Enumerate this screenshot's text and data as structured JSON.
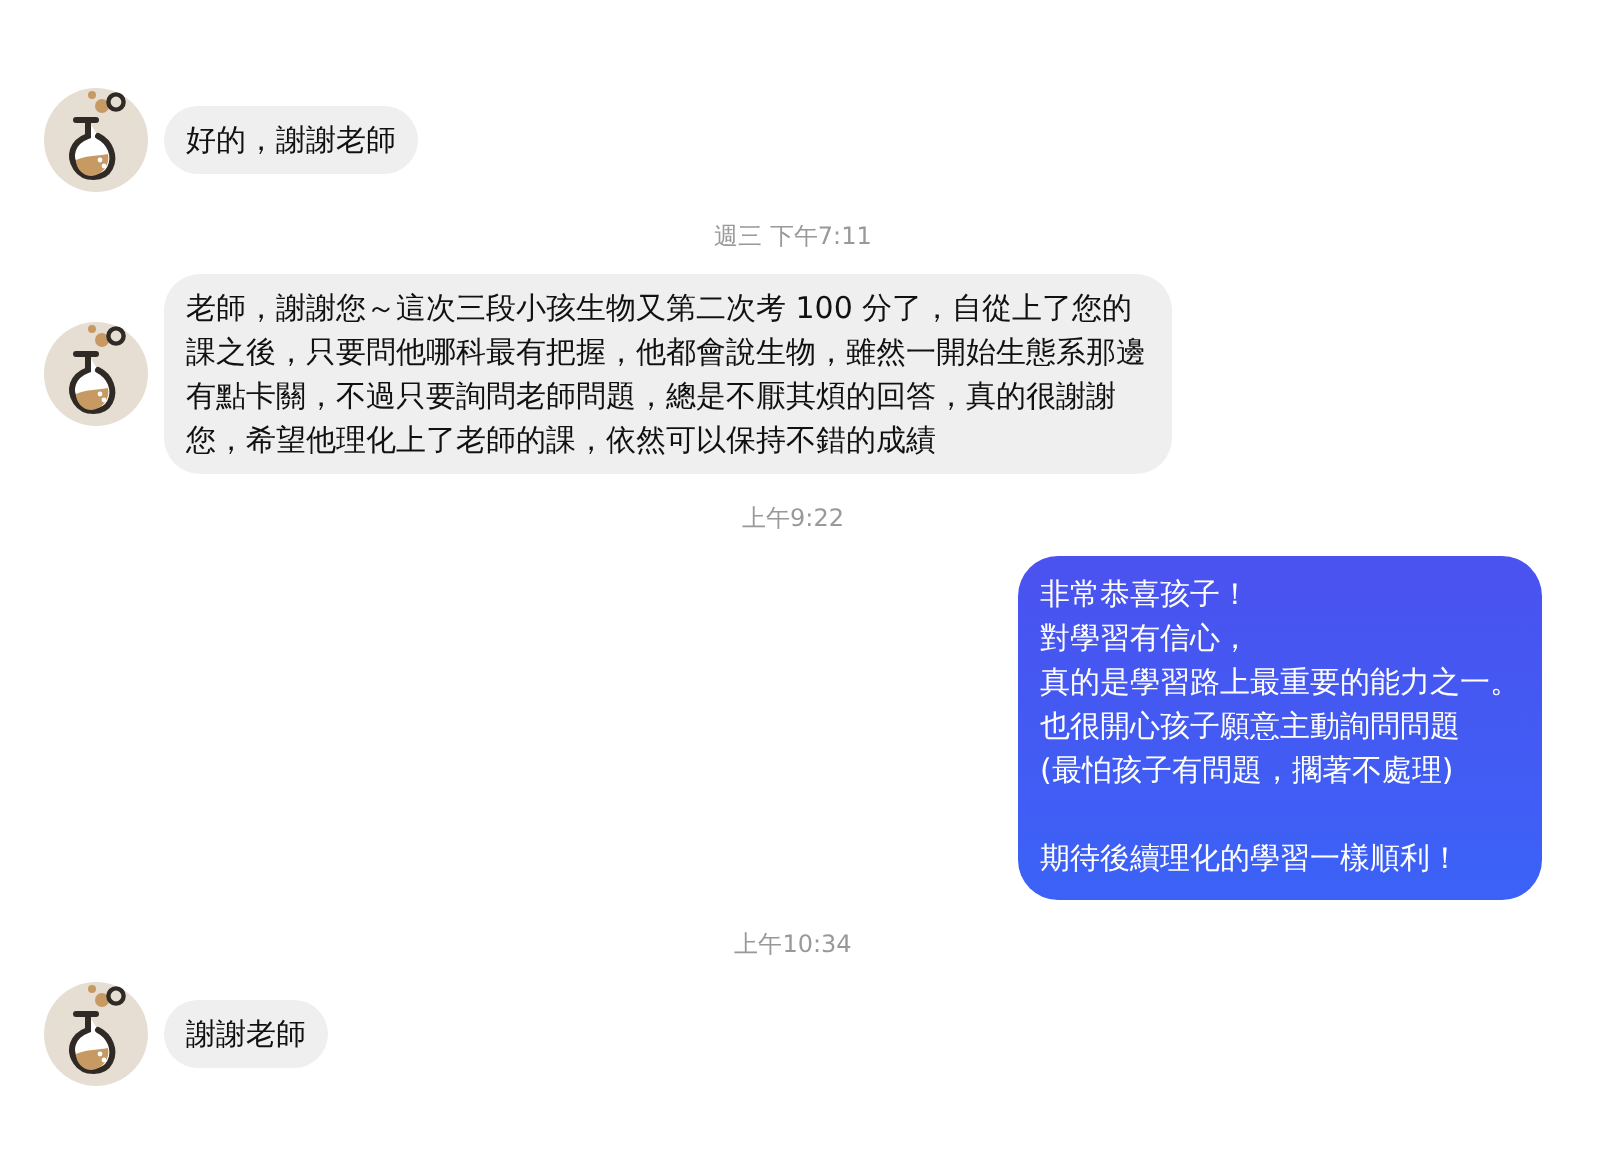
{
  "messages": [
    {
      "kind": "incoming",
      "text": "好的，謝謝老師"
    },
    {
      "kind": "time",
      "text": "週三 下午7:11"
    },
    {
      "kind": "incoming",
      "text": "老師，謝謝您～這次三段小孩生物又第二次考 100 分了，自從上了您的課之後，只要問他哪科最有把握，他都會說生物，雖然一開始生態系那邊有點卡關，不過只要詢問老師問題，總是不厭其煩的回答，真的很謝謝您，希望他理化上了老師的課，依然可以保持不錯的成績"
    },
    {
      "kind": "time",
      "text": "上午9:22"
    },
    {
      "kind": "outgoing",
      "paragraphs": [
        [
          "非常恭喜孩子！",
          "對學習有信心，",
          "真的是學習路上最重要的能力之一。",
          "也很開心孩子願意主動詢問問題",
          "(最怕孩子有問題，擱著不處理)"
        ],
        [
          "期待後續理化的學習一樣順利！"
        ]
      ]
    },
    {
      "kind": "time",
      "text": "上午10:34"
    },
    {
      "kind": "incoming",
      "text": "謝謝老師"
    }
  ]
}
